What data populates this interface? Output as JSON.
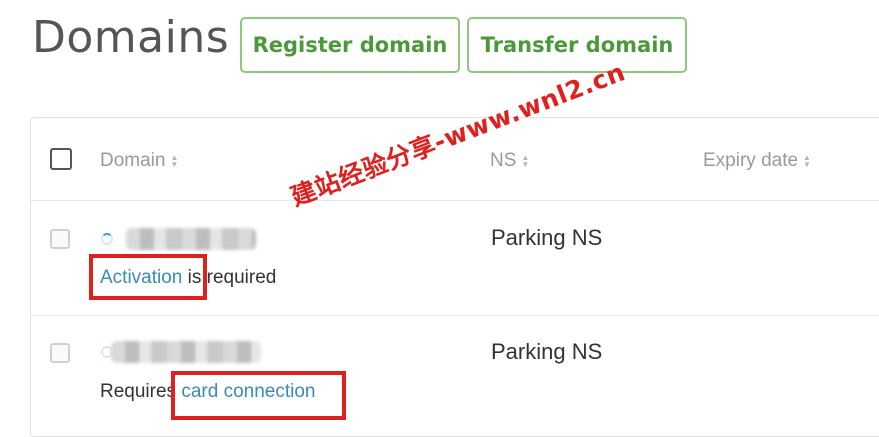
{
  "header": {
    "title": "Domains",
    "register_label": "Register domain",
    "transfer_label": "Transfer domain"
  },
  "table": {
    "columns": {
      "domain": "Domain",
      "ns": "NS",
      "expiry": "Expiry date"
    },
    "rows": [
      {
        "ns": "Parking NS",
        "status_link": "Activation",
        "status_suffix": " is required"
      },
      {
        "ns": "Parking NS",
        "status_prefix": "Requires ",
        "status_link": "card connection"
      }
    ]
  },
  "watermark": "建站经验分享-www.wnl2.cn",
  "icons": {
    "sort": "sort-icon",
    "loading": "spinner-icon"
  },
  "colors": {
    "button_border": "#8cc97c",
    "button_text": "#4a9a3a",
    "link": "#3a8ab8",
    "highlight": "#e0201e"
  }
}
